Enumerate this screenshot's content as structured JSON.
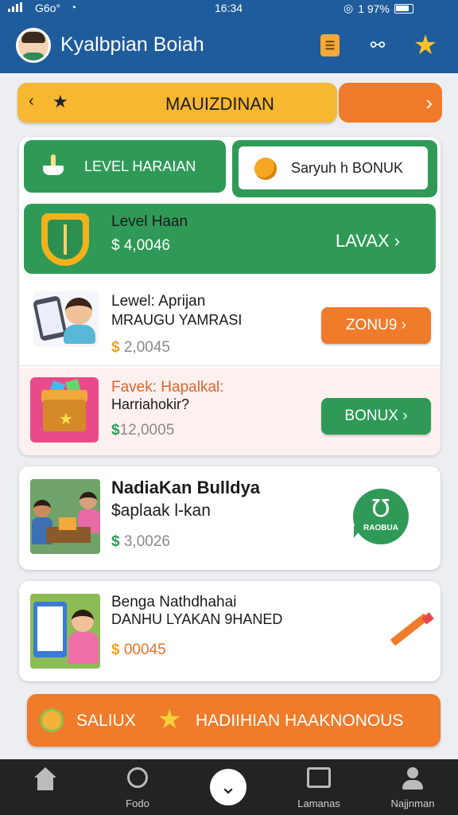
{
  "status_bar": {
    "carrier": "G6o°",
    "time": "16:34",
    "battery": "1 97%",
    "icons": [
      "signal-icon",
      "wifi-icon",
      "alarm-icon",
      "battery-icon"
    ]
  },
  "header": {
    "title": "Kyalbpian Boiah",
    "icons": [
      "avatar",
      "trophy-icon",
      "share-icon",
      "star-icon"
    ]
  },
  "banner": {
    "label": "MAUIZDINAN",
    "prev_glyph": "‹",
    "star_glyph": "★",
    "next_glyph": "›"
  },
  "panel": {
    "tabs": [
      {
        "label": "LEVEL HARAIAN",
        "icon": "plant-icon"
      },
      {
        "label": "Saryuh h BONUK",
        "icon": "coin-icon"
      }
    ],
    "hero": {
      "title": "Level Haan",
      "amount": "$ 4,0046",
      "cta": "LAVAX ›",
      "icon": "shield-icon"
    },
    "items": [
      {
        "title": "Lewel: Aprijan",
        "subtitle": "MRAUGU YAMRASI",
        "currency": "$",
        "value": "2,0045",
        "button": "ZONU9 ›"
      },
      {
        "title": "Favek: Hapalkal:",
        "subtitle": "Harriahokir?",
        "currency": "$",
        "value": "12,0005",
        "button": "BONUX ›"
      }
    ]
  },
  "cards": [
    {
      "title": "NadiaKan Bulldya",
      "subtitle": "$aplaak l-kan",
      "currency": "$",
      "value": "3,0026",
      "badge_glyph": "℧",
      "badge_label": "RAOBUA"
    },
    {
      "title": "Benga Nathdhahai",
      "subtitle": "DANHU LYAKAN 9HANED",
      "currency": "$",
      "value": "00045"
    }
  ],
  "cta": {
    "left_label": "SALIUX",
    "star_glyph": "★",
    "right_label": "HADIIHIAN HAAKNONOUS"
  },
  "bottom_nav": [
    {
      "label": "",
      "icon": "home-icon"
    },
    {
      "label": "Fodo",
      "icon": "circle-icon"
    },
    {
      "label": "",
      "icon": "chevron-down-icon",
      "glyph": "⌄"
    },
    {
      "label": "Lamanas",
      "icon": "image-icon"
    },
    {
      "label": "Najjnman",
      "icon": "user-icon"
    }
  ],
  "colors": {
    "header_blue": "#1f5c9c",
    "green": "#2f9a57",
    "orange": "#f07b2a",
    "yellow": "#f6b731"
  }
}
